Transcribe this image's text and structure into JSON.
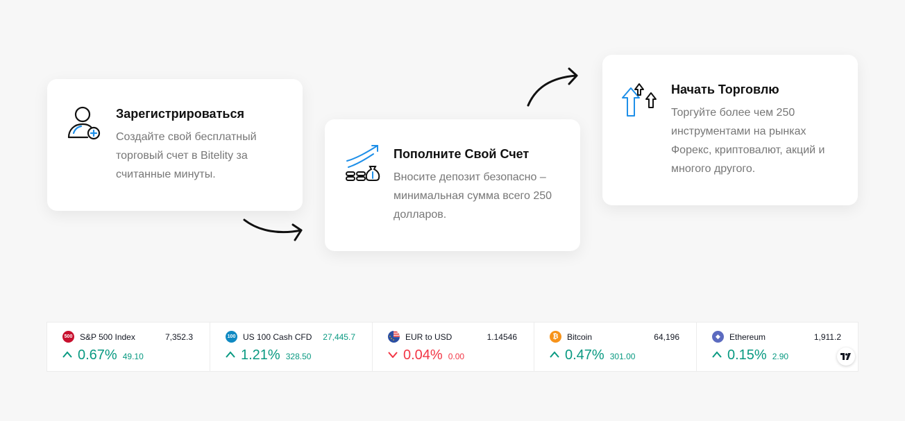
{
  "steps": [
    {
      "title": "Зарегистрироваться",
      "desc": "Создайте свой бесплатный торговый счет в Bitelity за считанные минуты.",
      "icon": "user-add-icon"
    },
    {
      "title": "Пополните Свой Счет",
      "desc": "Вносите депозит безопасно – минимальная сумма всего 250 долларов.",
      "icon": "coins-growth-icon"
    },
    {
      "title": "Начать Торговлю",
      "desc": "Торгуйте более чем 250 инструментами на рынках Форекс, криптовалют, акций и многого другого.",
      "icon": "arrows-up-icon"
    }
  ],
  "ticker": [
    {
      "icon_text": "500",
      "icon_color": "#c8102e",
      "name": "S&P 500 Index",
      "price": "7,352.3",
      "pct": "0.67%",
      "chg": "49.10",
      "dir": "up"
    },
    {
      "icon_text": "100",
      "icon_color": "#0f89c2",
      "name": "US 100 Cash CFD",
      "price": "27,445.7",
      "pct": "1.21%",
      "chg": "328.50",
      "dir": "up"
    },
    {
      "icon_text": "",
      "icon_color": "#2b4ea2",
      "name": "EUR to USD",
      "price": "1.14546",
      "pct": "0.04%",
      "chg": "0.00",
      "dir": "down"
    },
    {
      "icon_text": "₿",
      "icon_color": "#f7931a",
      "name": "Bitcoin",
      "price": "64,196",
      "pct": "0.47%",
      "chg": "301.00",
      "dir": "up"
    },
    {
      "icon_text": "◆",
      "icon_color": "#5c6bc0",
      "name": "Ethereum",
      "price": "1,911.2",
      "pct": "0.15%",
      "chg": "2.90",
      "dir": "up"
    }
  ],
  "colors": {
    "up": "#089981",
    "down": "#f23645",
    "accent": "#1e8fe8"
  }
}
